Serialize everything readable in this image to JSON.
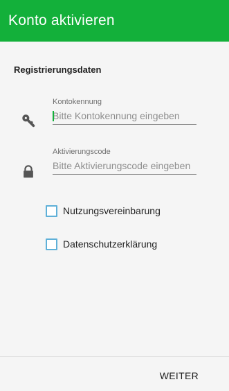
{
  "app_bar": {
    "title": "Konto aktivieren",
    "background_color": "#13b03a"
  },
  "form": {
    "section_title": "Registrierungsdaten",
    "fields": [
      {
        "label": "Kontokennung",
        "placeholder": "Bitte Kontokennung eingeben",
        "value": "",
        "icon": "key-icon",
        "focused": true
      },
      {
        "label": "Aktivierungscode",
        "placeholder": "Bitte Aktivierungscode eingeben",
        "value": "",
        "icon": "lock-icon",
        "focused": false
      }
    ],
    "checkboxes": [
      {
        "label": "Nutzungsvereinbarung",
        "checked": false
      },
      {
        "label": "Datenschutzerklärung",
        "checked": false
      }
    ]
  },
  "footer": {
    "next_label": "WEITER"
  }
}
